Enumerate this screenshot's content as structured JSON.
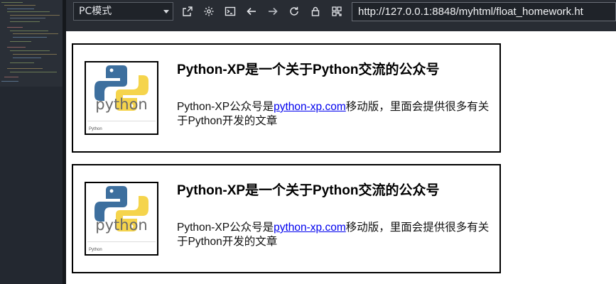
{
  "toolbar": {
    "mode_select": "PC模式",
    "url": "http://127.0.0.1:8848/myhtml/float_homework.ht",
    "buttons": [
      {
        "name": "new-window-icon"
      },
      {
        "name": "settings-icon"
      },
      {
        "name": "console-icon"
      },
      {
        "name": "back-arrow-icon"
      },
      {
        "name": "forward-arrow-icon"
      },
      {
        "name": "refresh-icon"
      },
      {
        "name": "lock-icon"
      },
      {
        "name": "qrcode-icon"
      }
    ]
  },
  "cards": [
    {
      "image_caption": "Python",
      "title": "Python-XP是一个关于Python交流的公众号",
      "text_before": "Python-XP公众号是",
      "link_text": "python-xp.com",
      "text_after": "移动版，里面会提供很多有关于Python开发的文章"
    },
    {
      "image_caption": "Python",
      "title": "Python-XP是一个关于Python交流的公众号",
      "text_before": "Python-XP公众号是",
      "link_text": "python-xp.com",
      "text_after": "移动版，里面会提供很多有关于Python开发的文章"
    }
  ],
  "colors": {
    "editor_bg": "#1f2329",
    "toolbar_bg": "#282c33",
    "link": "#0000ee",
    "python_blue": "#3d6f9e",
    "python_yellow": "#f5d44c"
  }
}
